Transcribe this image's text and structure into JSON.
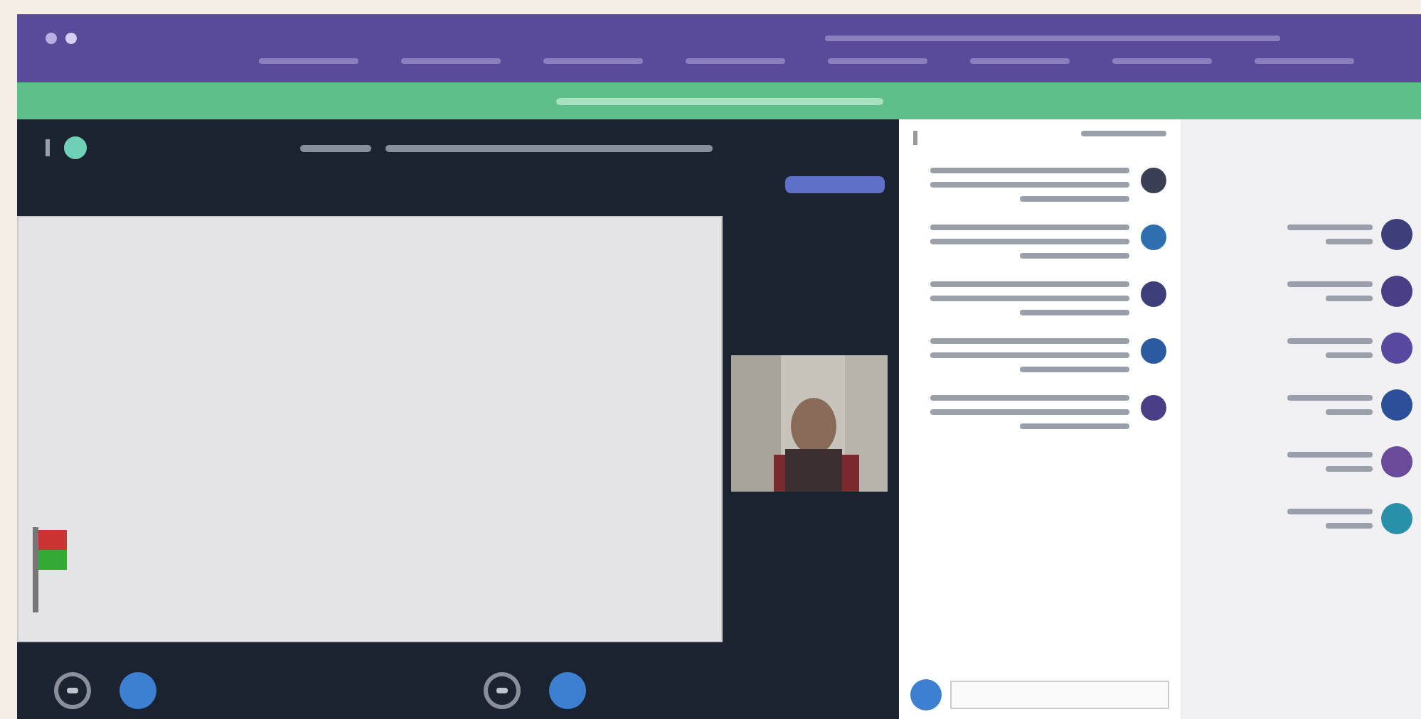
{
  "chat": {
    "messages": [
      {
        "color": "#3b3f55"
      },
      {
        "color": "#2f6fb0"
      },
      {
        "color": "#3d3f7a"
      },
      {
        "color": "#2c5aa0"
      },
      {
        "color": "#4a3f86"
      }
    ]
  },
  "users": [
    {
      "color": "#3d3f7a"
    },
    {
      "color": "#4a3f86"
    },
    {
      "color": "#5a48a0"
    },
    {
      "color": "#2c4f9a"
    },
    {
      "color": "#6a4a9a"
    },
    {
      "color": "#2a8fa8"
    }
  ],
  "toolbar": [
    {
      "kind": "status"
    },
    {
      "kind": "audio"
    },
    {
      "kind": "camera"
    },
    {
      "kind": "share"
    }
  ]
}
